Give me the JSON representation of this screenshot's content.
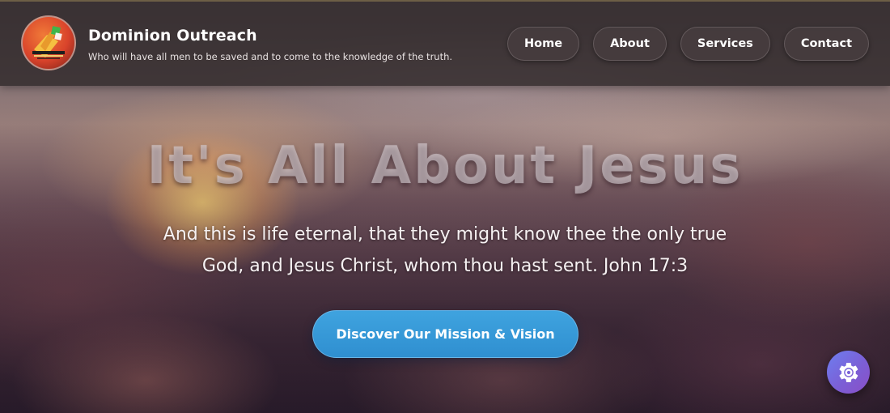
{
  "header": {
    "brand_title": "Dominion Outreach",
    "tagline": "Who will have all men to be saved and to come to the knowledge of the truth.",
    "logo_icon": "logo-icon",
    "nav": [
      {
        "label": "Home"
      },
      {
        "label": "About"
      },
      {
        "label": "Services"
      },
      {
        "label": "Contact"
      }
    ]
  },
  "hero": {
    "title": "It's All About Jesus",
    "verse": "And this is life eternal, that they might know thee the only true God, and Jesus Christ, whom thou hast sent. John 17:3",
    "cta_label": "Discover Our Mission & Vision"
  },
  "floating": {
    "settings_icon": "gear-icon"
  },
  "colors": {
    "header_bg": "#30282a",
    "cta_blue": "#3399d6",
    "fab_gradient_start": "#6d7ff0",
    "fab_gradient_end": "#8a4fc6",
    "text_white": "#ffffff"
  }
}
